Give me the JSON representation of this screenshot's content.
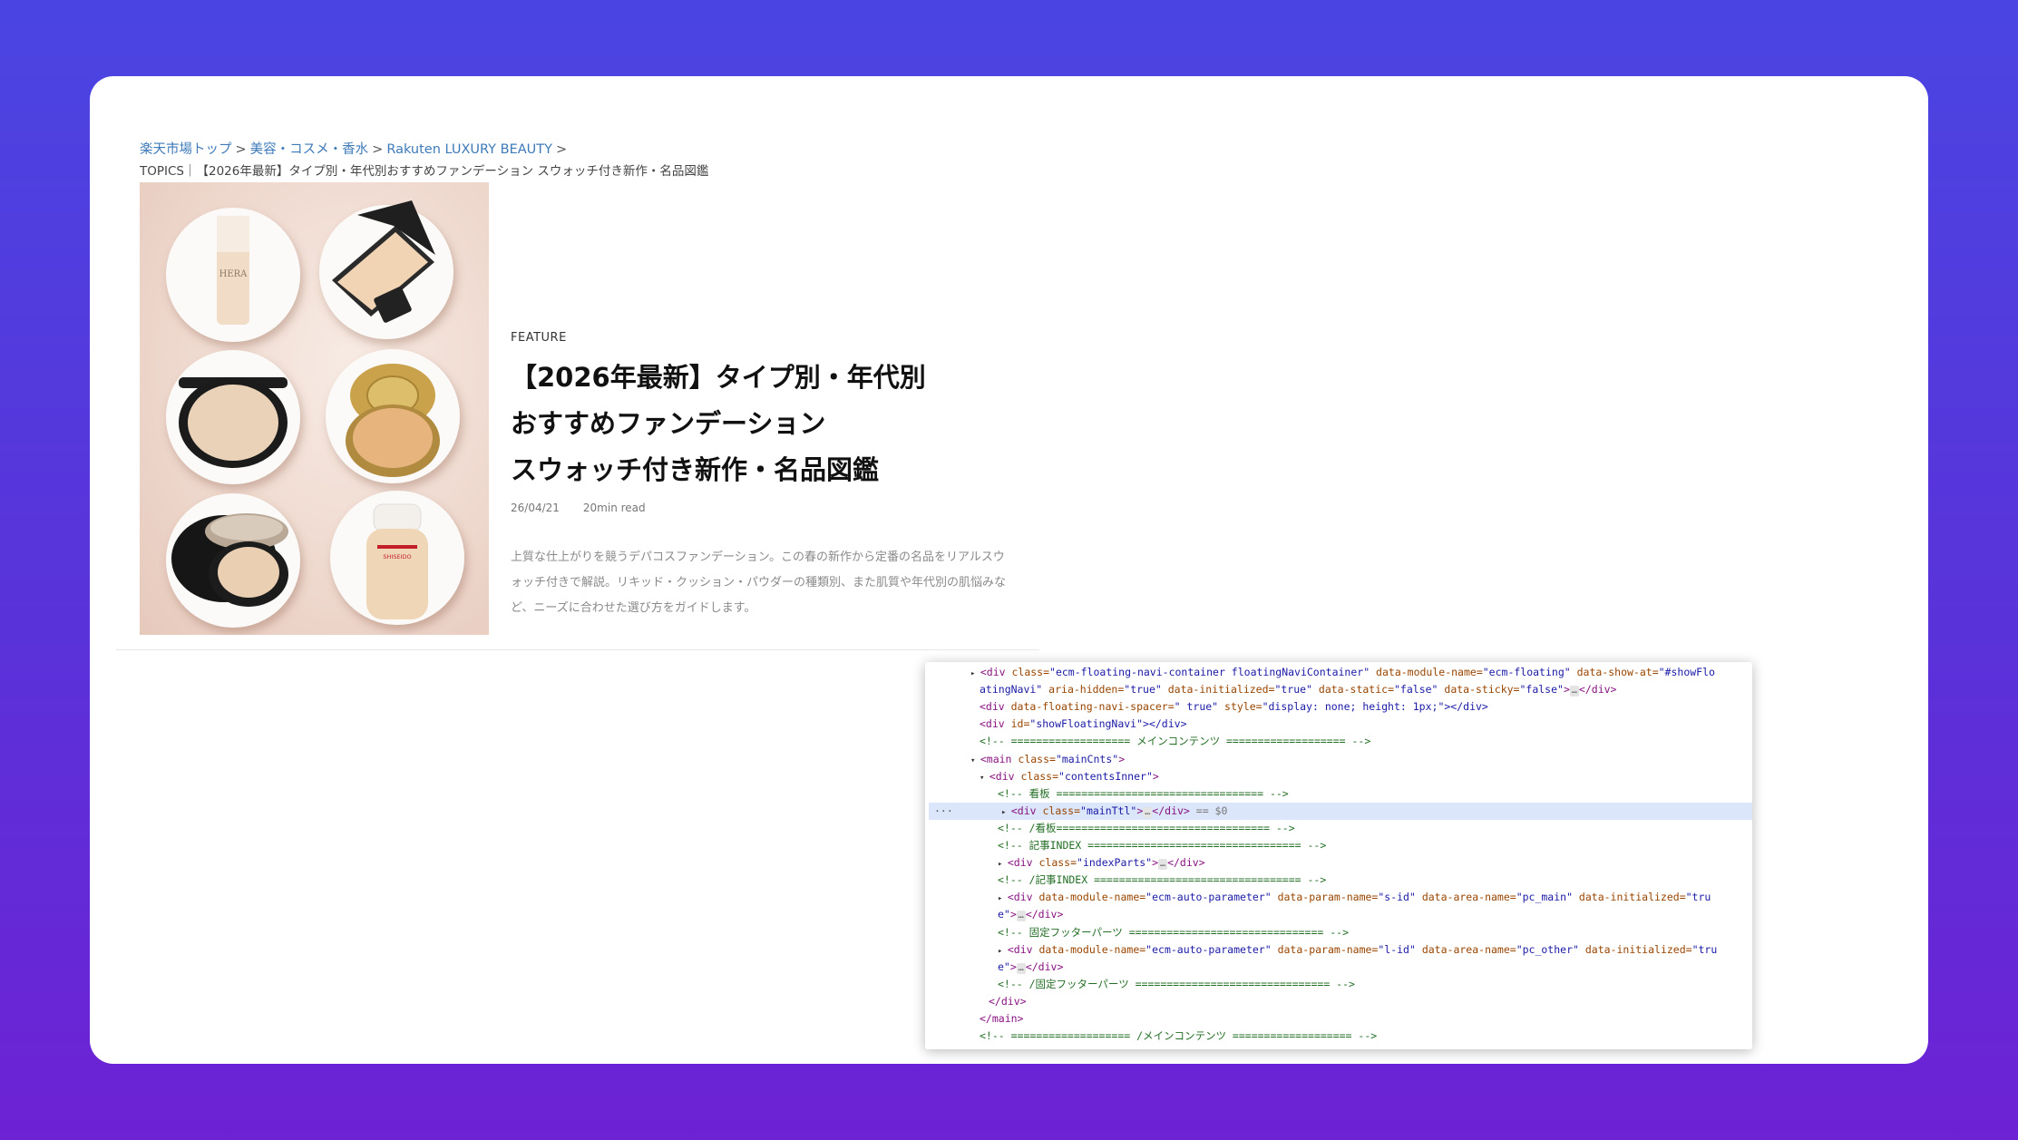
{
  "breadcrumb": {
    "items": [
      "楽天市場トップ",
      "美容・コスメ・香水",
      "Rakuten LUXURY BEAUTY"
    ],
    "separator": ">",
    "current": "TOPICS｜【2026年最新】タイプ別・年代別おすすめファンデーション スウォッチ付き新作・名品図鑑"
  },
  "article": {
    "label": "FEATURE",
    "title_lines": [
      "【2026年最新】タイプ別・年代別",
      "おすすめファンデーション",
      "スウォッチ付き新作・名品図鑑"
    ],
    "date": "26/04/21",
    "read_time": "20min read",
    "summary": "上質な仕上がりを競うデパコスファンデーション。この春の新作から定番の名品をリアルスウォッチ付きで解説。リキッド・クッション・パウダーの種類別、また肌質や年代別の肌悩みなど、ニーズに合わせた選び方をガイドします。",
    "image_labels": [
      "HERA",
      "SHISEIDO"
    ]
  },
  "devtools": {
    "selected_marker": "== $0",
    "lines": [
      {
        "t": "▸",
        "parts": [
          "<div ",
          "class=",
          "\"ecm-floating-navi-container floatingNaviContainer\"",
          " data-module-name=",
          "\"ecm-floating\"",
          " data-show-at=",
          "\"#showFlo"
        ]
      },
      {
        "t": "",
        "parts": [
          "atingNavi\"",
          " aria-hidden=",
          "\"true\"",
          " data-initialized=",
          "\"true\"",
          " data-static=",
          "\"false\"",
          " data-sticky=",
          "\"false\"",
          ">",
          "…",
          "</div>"
        ]
      },
      {
        "t": "",
        "parts": [
          "<div ",
          "data-floating-navi-spacer=",
          "\" true\"",
          " style=",
          "\"display: none; height: 1px;\"",
          "></div>"
        ]
      },
      {
        "t": "",
        "parts": [
          "<div ",
          "id=",
          "\"showFloatingNavi\"",
          "></div>"
        ]
      },
      {
        "comment": "<!-- =================== メインコンテンツ =================== -->"
      },
      {
        "t": "▾",
        "parts": [
          "<main ",
          "class=",
          "\"mainCnts\"",
          ">"
        ]
      },
      {
        "t": "▾",
        "parts": [
          "<div ",
          "class=",
          "\"contentsInner\"",
          ">"
        ]
      },
      {
        "comment": "<!-- 看板 ================================= -->"
      },
      {
        "t": "▸",
        "parts": [
          "<div ",
          "class=",
          "\"mainTtl\"",
          ">",
          "…",
          "</div>"
        ]
      },
      {
        "comment": "<!-- /看板================================== -->"
      },
      {
        "comment": "<!-- 記事INDEX ================================== -->"
      },
      {
        "t": "▸",
        "parts": [
          "<div ",
          "class=",
          "\"indexParts\"",
          ">",
          "…",
          "</div>"
        ]
      },
      {
        "comment": "<!-- /記事INDEX ================================= -->"
      },
      {
        "t": "▸",
        "parts": [
          "<div ",
          "data-module-name=",
          "\"ecm-auto-parameter\"",
          " data-param-name=",
          "\"s-id\"",
          " data-area-name=",
          "\"pc_main\"",
          " data-initialized=",
          "\"tru"
        ]
      },
      {
        "t": "",
        "parts": [
          "e\"",
          ">",
          "…",
          "</div>"
        ]
      },
      {
        "comment": "<!-- 固定フッターパーツ =============================== -->"
      },
      {
        "t": "▸",
        "parts": [
          "<div ",
          "data-module-name=",
          "\"ecm-auto-parameter\"",
          " data-param-name=",
          "\"l-id\"",
          " data-area-name=",
          "\"pc_other\"",
          " data-initialized=",
          "\"tru"
        ]
      },
      {
        "t": "",
        "parts": [
          "e\"",
          ">",
          "…",
          "</div>"
        ]
      },
      {
        "comment": "<!-- /固定フッターパーツ =============================== -->"
      },
      {
        "t": "",
        "parts": [
          "</div>"
        ]
      },
      {
        "t": "",
        "parts": [
          "</main>"
        ]
      },
      {
        "comment": "<!-- =================== /メインコンテンツ =================== -->"
      }
    ]
  },
  "colors": {
    "background_top": "#4a45e2",
    "background_bottom": "#6d22d4",
    "link": "#3e7ab8",
    "devtools_tag": "#881280",
    "devtools_attr": "#994500",
    "devtools_value": "#1a1aa6",
    "devtools_comment": "#236e25",
    "devtools_selection": "#dbe6fb"
  }
}
